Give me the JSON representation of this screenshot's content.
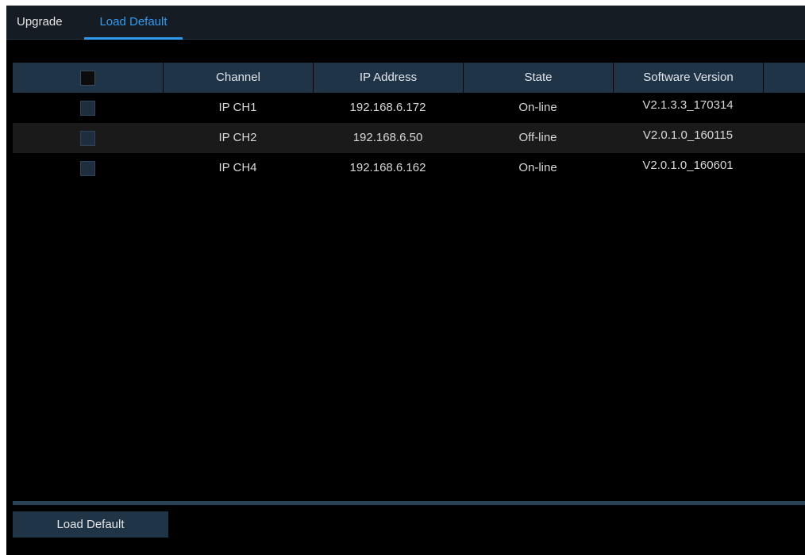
{
  "tabs": [
    {
      "label": "Upgrade",
      "active": false
    },
    {
      "label": "Load Default",
      "active": true
    }
  ],
  "table": {
    "columns": [
      "",
      "Channel",
      "IP Address",
      "State",
      "Software Version",
      ""
    ],
    "header_checkbox_checked": false,
    "rows": [
      {
        "checked": false,
        "channel": "IP CH1",
        "ip": "192.168.6.172",
        "state": "On-line",
        "version": "V2.1.3.3_170314"
      },
      {
        "checked": false,
        "channel": "IP CH2",
        "ip": "192.168.6.50",
        "state": "Off-line",
        "version": "V2.0.1.0_160115"
      },
      {
        "checked": false,
        "channel": "IP CH4",
        "ip": "192.168.6.162",
        "state": "On-line",
        "version": "V2.0.1.0_160601"
      }
    ]
  },
  "actions": {
    "load_default_label": "Load Default"
  },
  "colors": {
    "accent": "#2f9cf0",
    "header_bg": "#203448",
    "background": "#000000"
  }
}
